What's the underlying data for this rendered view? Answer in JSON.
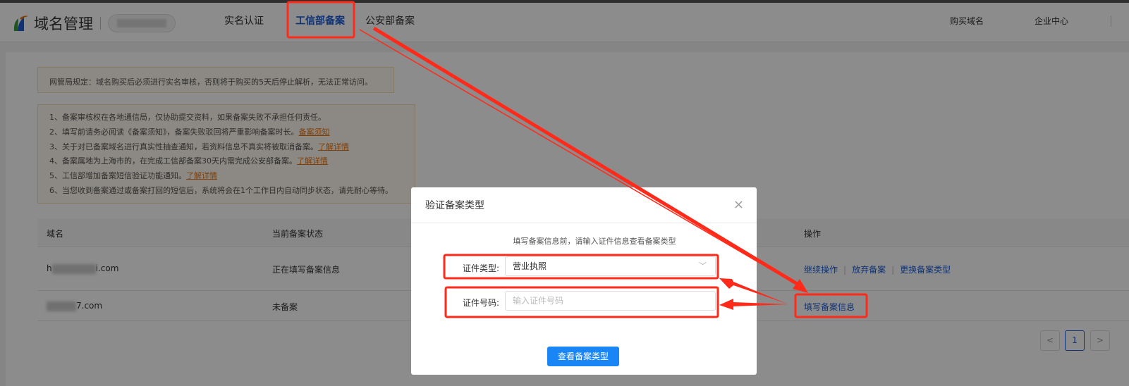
{
  "header": {
    "logo_text": "域名管理",
    "nav": [
      "实名认证",
      "工信部备案",
      "公安部备案"
    ],
    "right": [
      "购买域名",
      "企业中心"
    ]
  },
  "notices": {
    "regulation": "网管局规定：域名购买后必须进行实名审核，否则将于购买的5天后停止解析，无法正常访问。",
    "items": [
      {
        "text": "1、备案审核权在各地通信局，仅协助提交资料，如果备案失败不承担任何责任。",
        "link": ""
      },
      {
        "text": "2、填写前请务必阅读《备案须知》，备案失败驳回将严重影响备案时长。",
        "link": "备案须知"
      },
      {
        "text": "3、关于对已备案域名进行真实性抽查通知，若资料信息不真实将被取消备案。",
        "link": "了解详情"
      },
      {
        "text": "4、备案属地为上海市的，在完成工信部备案30天内需完成公安部备案。",
        "link": "了解详情"
      },
      {
        "text": "5、工信部增加备案短信验证功能通知。",
        "link": "了解详情"
      },
      {
        "text": "6、当您收到备案通过或备案打回的短信后，系统将会在1个工作日内自动同步状态，请先耐心等待。",
        "link": ""
      }
    ]
  },
  "table": {
    "headers": [
      "域名",
      "当前备案状态",
      "操作"
    ],
    "rows": [
      {
        "domain_prefix": "h",
        "domain_suffix": "i.com",
        "status": "正在填写备案信息",
        "actions": [
          "继续操作",
          "放弃备案",
          "更换备案类型"
        ]
      },
      {
        "domain_prefix": "",
        "domain_suffix": "7.com",
        "status": "未备案",
        "actions": [
          "填写备案信息"
        ]
      }
    ]
  },
  "pagination": {
    "prev": "<",
    "current": "1",
    "next": ">"
  },
  "modal": {
    "title": "验证备案类型",
    "close": "×",
    "intro": "填写备案信息前，请输入证件信息查看备案类型",
    "cert_type_label": "证件类型:",
    "cert_type_value": "营业执照",
    "cert_no_label": "证件号码:",
    "cert_no_placeholder": "输入证件号码",
    "submit": "查看备案类型"
  },
  "colors": {
    "accent": "#1a5bd6",
    "button": "#1a86f5",
    "annotation": "#ff2a1a"
  }
}
